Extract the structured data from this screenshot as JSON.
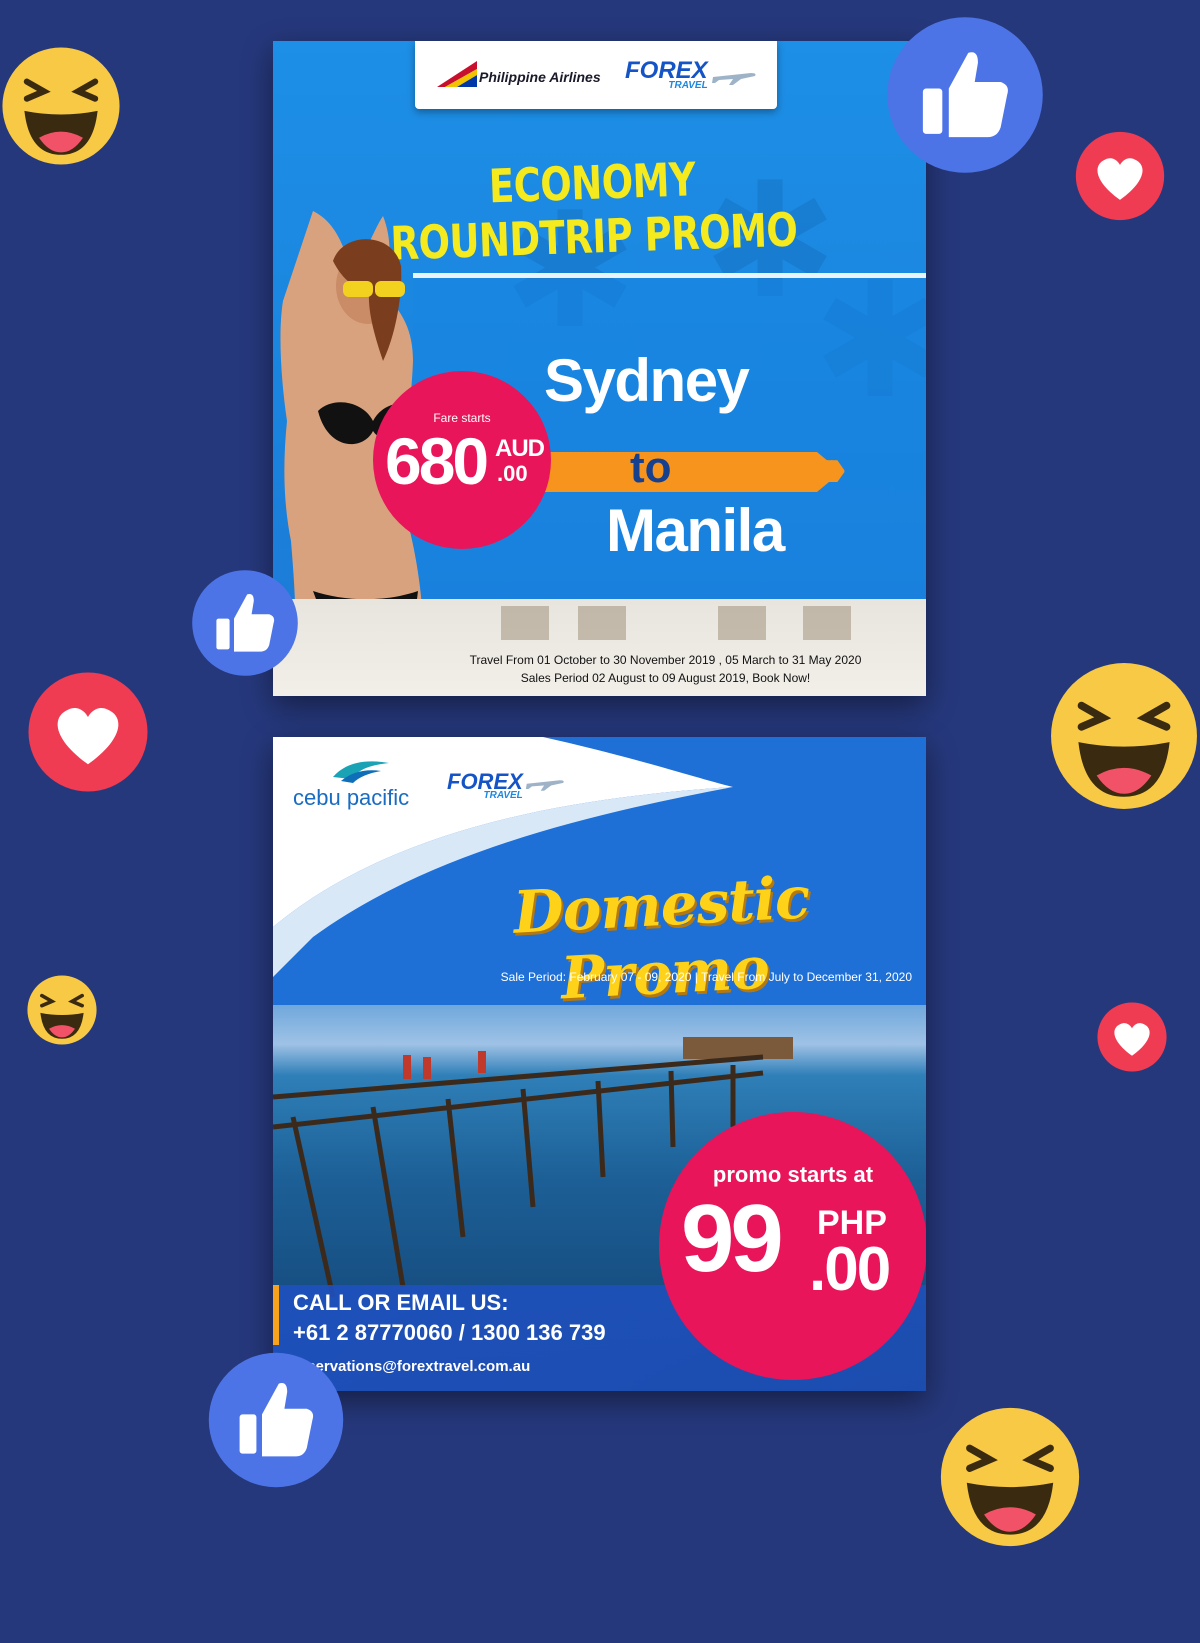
{
  "card1": {
    "airline": "Philippine Airlines",
    "agency": {
      "name": "FOREX",
      "sub": "TRAVEL"
    },
    "headline": "ECONOMY ROUNDTRIP PROMO",
    "fare": {
      "label": "Fare starts",
      "amount": "680",
      "currency": "AUD",
      "decimal": ".00"
    },
    "route": {
      "from": "Sydney",
      "connector": "to",
      "to": "Manila"
    },
    "travel_period": "Travel From 01 October to 30 November 2019 , 05 March to 31 May 2020",
    "sales_period": "Sales Period 02 August to 09 August 2019, Book Now!"
  },
  "card2": {
    "airline": "cebu pacific",
    "agency": {
      "name": "FOREX",
      "sub": "TRAVEL"
    },
    "headline": "Domestic Promo",
    "sale_info": "Sale Period: February 07 - 09, 2020 | Travel From July to December 31, 2020",
    "promo": {
      "label": "promo starts at",
      "amount": "99",
      "currency": "PHP",
      "decimal": ".00"
    },
    "contact": {
      "heading": "CALL OR EMAIL US:",
      "phone": "+61 2 87770060 / 1300 136 739",
      "email": "reservations@forextravel.com.au"
    }
  },
  "reactions": [
    "laugh-icon",
    "like-icon",
    "love-icon",
    "like-icon",
    "love-icon",
    "laugh-icon",
    "laugh-icon",
    "love-icon",
    "like-icon",
    "laugh-icon"
  ],
  "colors": {
    "background": "#26387c",
    "accent_pink": "#e8155a",
    "accent_orange": "#f7941d",
    "headline_yellow": "#f5ea1e"
  }
}
